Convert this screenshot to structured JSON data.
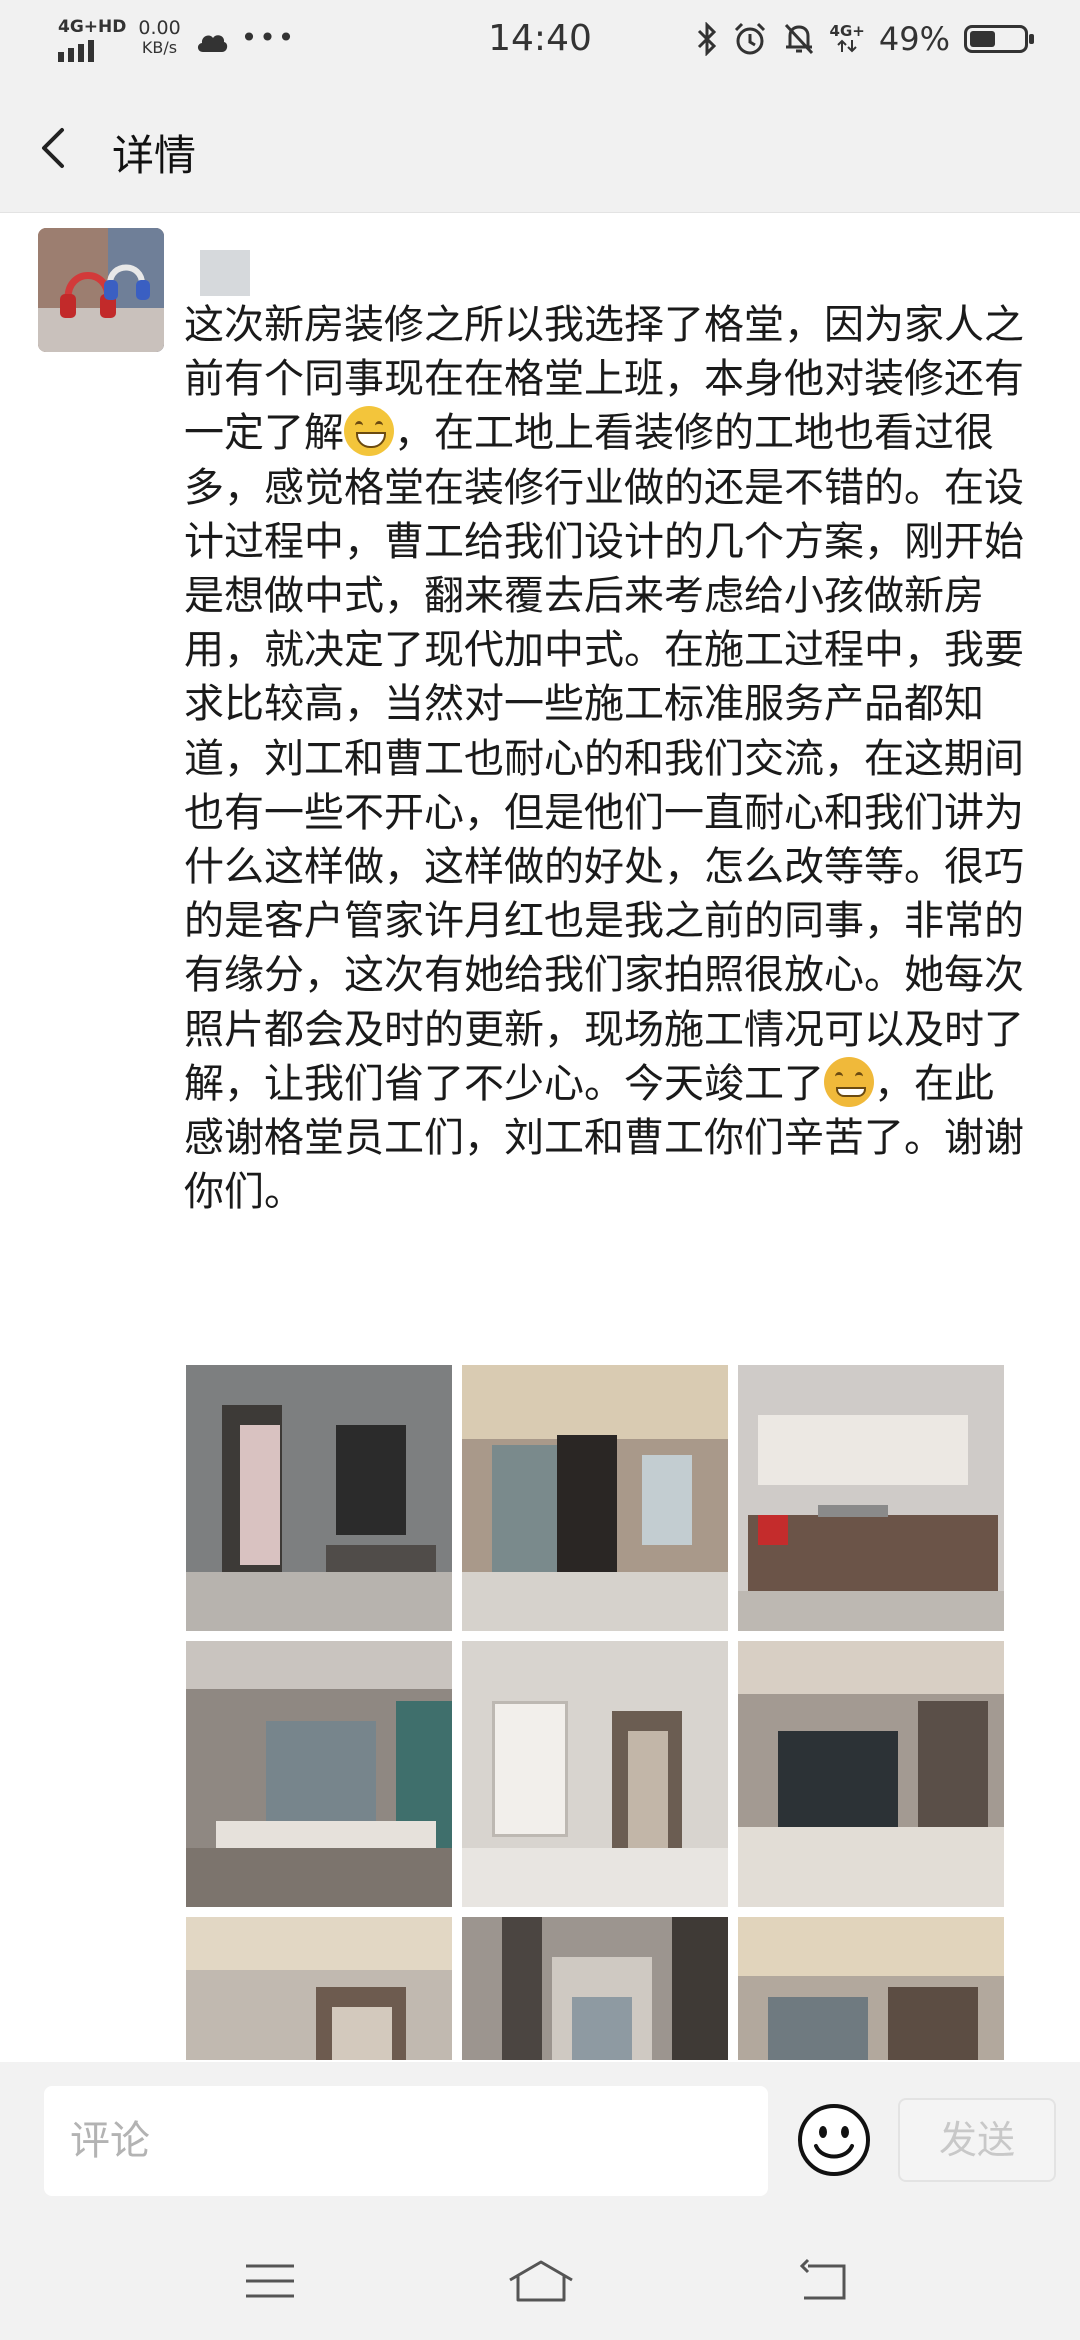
{
  "status_bar": {
    "network_label": "4G+HD",
    "speed_value": "0.00",
    "speed_unit": "KB/s",
    "time": "14:40",
    "network_right": "4G+",
    "battery_percent": "49%",
    "battery_level": 0.49
  },
  "header": {
    "back_icon": "chevron-left-icon",
    "title": "详情"
  },
  "post": {
    "text_part1": "这次新房装修之所以我选择了格堂，因为家人之前有个同事现在在格堂上班，本身他对装修还有一定了解",
    "emoji1": "grinning-face-emoji",
    "text_part2": "，在工地上看装修的工地也看过很多，感觉格堂在装修行业做的还是不错的。在设计过程中，曹工给我们设计的几个方案，刚开始是想做中式，翻来覆去后来考虑给小孩做新房用，就决定了现代加中式。在施工过程中，我要求比较高，当然对一些施工标准服务产品都知道，刘工和曹工也耐心的和我们交流，在这期间也有一些不开心，但是他们一直耐心和我们讲为什么这样做，这样做的好处，怎么改等等。很巧的是客户管家许月红也是我之前的同事，非常的有缘分，这次有她给我们家拍照很放心。她每次照片都会及时的更新，现场施工情况可以及时了解，让我们省了不少心。今天竣工了",
    "emoji2": "hugging-face-emoji",
    "text_part3": "，在此感谢格堂员工们，刘工和曹工你们辛苦了。谢谢你们。",
    "photos": [
      "bathroom-photo",
      "living-room-photo",
      "kitchen-photo",
      "bay-window-room-photo",
      "hallway-shelf-photo",
      "dining-room-photo",
      "ceiling-room-photo",
      "corridor-photo",
      "chandelier-room-photo"
    ]
  },
  "comment_bar": {
    "placeholder": "评论",
    "emoji_icon": "smiley-face-icon",
    "send_label": "发送"
  },
  "nav_bar": {
    "menu_icon": "menu-icon",
    "home_icon": "home-icon",
    "back_icon": "back-arrow-icon"
  },
  "colors": {
    "status_bar_bg": "#f1f1f1",
    "text": "#1a1a1a",
    "placeholder": "#b3b3b3",
    "send_disabled": "#c8c8c8"
  }
}
